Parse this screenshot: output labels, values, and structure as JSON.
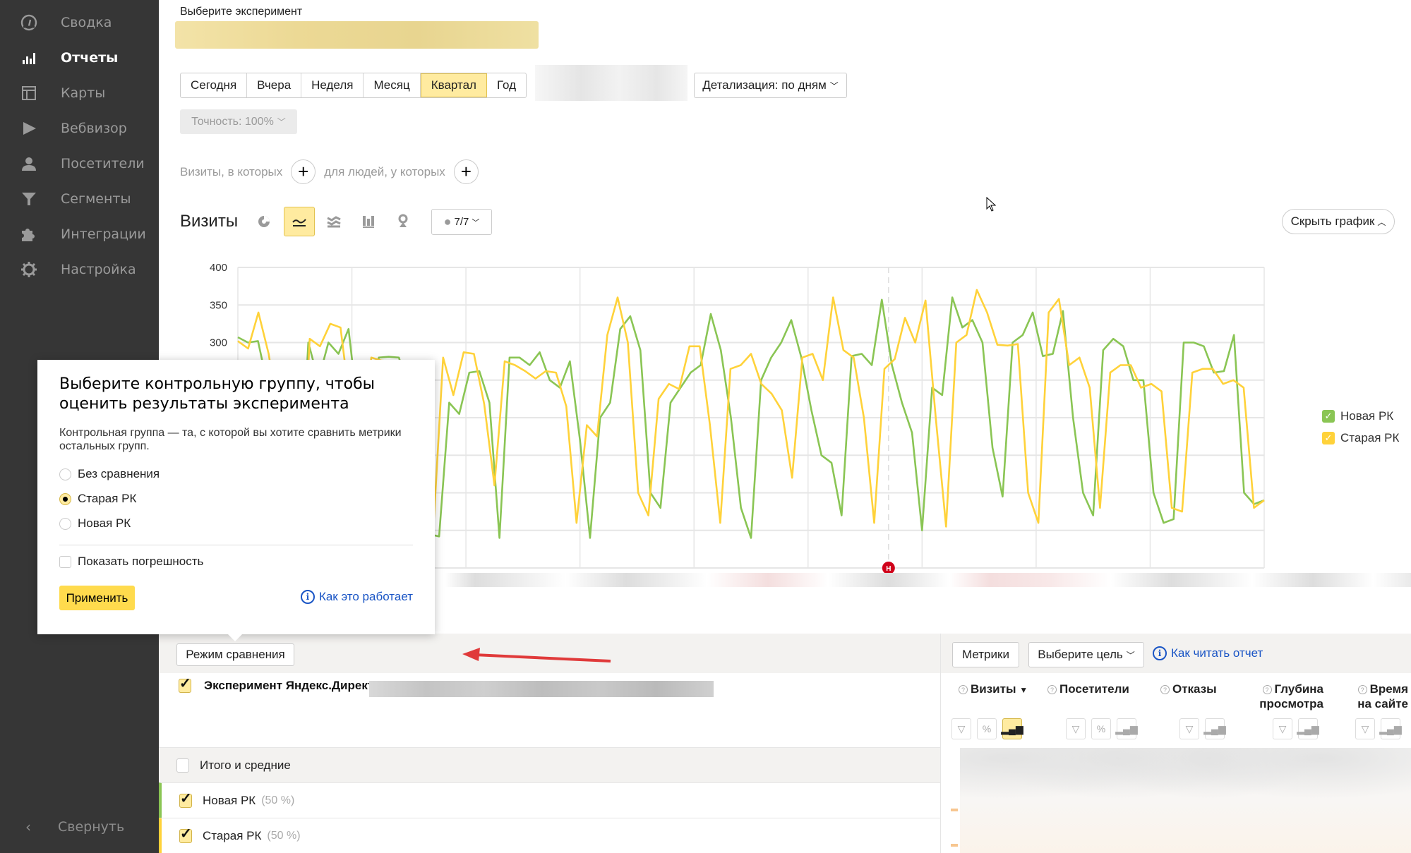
{
  "sidebar": {
    "items": [
      {
        "label": "Сводка",
        "icon": "dashboard-icon",
        "active": false
      },
      {
        "label": "Отчеты",
        "icon": "bar-chart-icon",
        "active": true
      },
      {
        "label": "Карты",
        "icon": "map-layout-icon",
        "active": false
      },
      {
        "label": "Вебвизор",
        "icon": "play-icon",
        "active": false
      },
      {
        "label": "Посетители",
        "icon": "user-icon",
        "active": false
      },
      {
        "label": "Сегменты",
        "icon": "filter-icon",
        "active": false
      },
      {
        "label": "Интеграции",
        "icon": "puzzle-icon",
        "active": false
      },
      {
        "label": "Настройка",
        "icon": "gear-icon",
        "active": false
      }
    ],
    "collapse_label": "Свернуть"
  },
  "header": {
    "experiment_label": "Выберите эксперимент",
    "periods": [
      "Сегодня",
      "Вчера",
      "Неделя",
      "Месяц",
      "Квартал",
      "Год"
    ],
    "selected_period": "Квартал",
    "detail_label": "Детализация: по дням",
    "accuracy_label": "Точность: 100%",
    "segment_visits_label": "Визиты, в которых",
    "segment_people_label": "для людей, у которых"
  },
  "chart_panel": {
    "title": "Визиты",
    "chart_types": [
      "pie-chart-icon",
      "line-chart-icon",
      "area-chart-icon",
      "column-chart-icon",
      "map-pin-icon"
    ],
    "selected_chart_type": "line-chart-icon",
    "notes_label": "7/7",
    "hide_chart_label": "Скрыть график",
    "annotation_marker": "Н"
  },
  "chart_data": {
    "type": "line",
    "title": "Визиты",
    "xlabel": "",
    "ylabel": "",
    "ylim": [
      0,
      400
    ],
    "yticks": [
      400,
      350,
      300
    ],
    "grid": true,
    "legend_position": "right",
    "series": [
      {
        "name": "Новая РК",
        "color": "#8ac554",
        "values": [
          307,
          300,
          302,
          240,
          170,
          60,
          50,
          300,
          250,
          300,
          285,
          318,
          200,
          160,
          280,
          281,
          280,
          240,
          160,
          45,
          42,
          220,
          205,
          260,
          262,
          220,
          40,
          280,
          280,
          270,
          287,
          250,
          240,
          275,
          170,
          40,
          200,
          220,
          318,
          335,
          290,
          100,
          80,
          220,
          240,
          260,
          270,
          338,
          290,
          200,
          80,
          40,
          250,
          280,
          300,
          330,
          280,
          210,
          150,
          140,
          70,
          282,
          285,
          270,
          357,
          270,
          220,
          180,
          50,
          240,
          230,
          360,
          320,
          330,
          300,
          160,
          95,
          300,
          310,
          340,
          282,
          285,
          342,
          200,
          100,
          70,
          290,
          305,
          295,
          250,
          250,
          100,
          60,
          65,
          300,
          300,
          295,
          260,
          262,
          310,
          100,
          85,
          90
        ],
        "display_values": "sampled"
      },
      {
        "name": "Старая РК",
        "color": "#ffd23a",
        "values": [
          302,
          292,
          340,
          285,
          200,
          55,
          45,
          305,
          295,
          325,
          320,
          210,
          150,
          280,
          276,
          275,
          230,
          100,
          40,
          42,
          280,
          230,
          287,
          285,
          218,
          110,
          275,
          270,
          262,
          252,
          262,
          260,
          215,
          60,
          190,
          175,
          310,
          360,
          300,
          100,
          70,
          225,
          245,
          238,
          295,
          295,
          190,
          60,
          265,
          270,
          285,
          245,
          232,
          210,
          120,
          280,
          285,
          250,
          360,
          290,
          280,
          200,
          60,
          265,
          278,
          333,
          300,
          356,
          200,
          55,
          300,
          310,
          370,
          340,
          297,
          296,
          298,
          100,
          60,
          340,
          358,
          270,
          280,
          240,
          80,
          260,
          270,
          270,
          240,
          245,
          235,
          80,
          75,
          260,
          265,
          265,
          245,
          250,
          240,
          80,
          90
        ]
      }
    ]
  },
  "legend": [
    "Новая РК",
    "Старая РК"
  ],
  "popup": {
    "title": "Выберите контрольную группу, чтобы оценить результаты эксперимента",
    "description": "Контрольная группа — та, с которой вы хотите сравнить метрики остальных групп.",
    "options": [
      "Без сравнения",
      "Старая РК",
      "Новая РК"
    ],
    "selected_option": "Старая РК",
    "show_error_label": "Показать погрешность",
    "show_error_checked": false,
    "apply_label": "Применить",
    "how_it_works_label": "Как это работает"
  },
  "report": {
    "compare_mode_label": "Режим сравнения",
    "metrics_label": "Метрики",
    "goal_label": "Выберите цель",
    "how_to_read_label": "Как читать отчет",
    "grouping_label": "Эксперимент Яндекс.Директа",
    "columns": [
      {
        "label": "Визиты",
        "sorted": "desc"
      },
      {
        "label": "Посетители"
      },
      {
        "label": "Отказы"
      },
      {
        "label": "Глубина просмотра"
      },
      {
        "label": "Время на сайте"
      }
    ],
    "rows": [
      {
        "label": "Итого и средние",
        "checked": false,
        "pct": ""
      },
      {
        "label": "Новая РК",
        "checked": true,
        "pct": "(50 %)",
        "color": "#8ac554"
      },
      {
        "label": "Старая РК",
        "checked": true,
        "pct": "(50 %)",
        "color": "#ffd23a"
      }
    ]
  }
}
